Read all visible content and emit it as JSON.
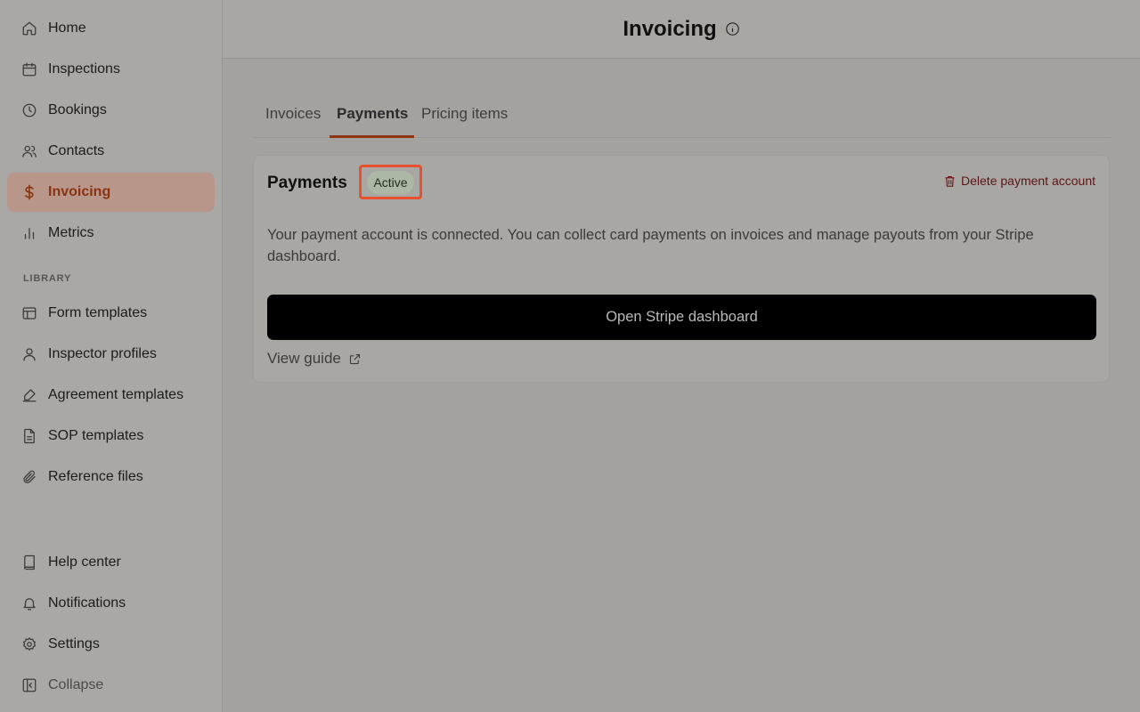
{
  "sidebar": {
    "items": [
      {
        "label": "Home",
        "icon": "home-icon"
      },
      {
        "label": "Inspections",
        "icon": "calendar-icon"
      },
      {
        "label": "Bookings",
        "icon": "clock-icon"
      },
      {
        "label": "Contacts",
        "icon": "users-icon"
      },
      {
        "label": "Invoicing",
        "icon": "dollar-icon",
        "active": true
      },
      {
        "label": "Metrics",
        "icon": "bar-chart-icon"
      }
    ],
    "library_label": "LIBRARY",
    "library_items": [
      {
        "label": "Form templates",
        "icon": "layout-icon"
      },
      {
        "label": "Inspector profiles",
        "icon": "user-icon"
      },
      {
        "label": "Agreement templates",
        "icon": "signature-icon"
      },
      {
        "label": "SOP templates",
        "icon": "document-icon"
      },
      {
        "label": "Reference files",
        "icon": "paperclip-icon"
      }
    ],
    "bottom_items": [
      {
        "label": "Help center",
        "icon": "book-icon"
      },
      {
        "label": "Notifications",
        "icon": "bell-icon"
      },
      {
        "label": "Settings",
        "icon": "gear-icon"
      },
      {
        "label": "Collapse",
        "icon": "sidebar-collapse-icon"
      }
    ]
  },
  "header": {
    "title": "Invoicing",
    "info_icon": "info-icon"
  },
  "tabs": [
    {
      "label": "Invoices"
    },
    {
      "label": "Payments",
      "active": true
    },
    {
      "label": "Pricing items"
    }
  ],
  "card": {
    "title": "Payments",
    "status_badge": "Active",
    "delete_label": "Delete payment account",
    "description": "Your payment account is connected. You can collect card payments on invoices and manage payouts from your Stripe dashboard.",
    "primary_button": "Open Stripe dashboard",
    "guide_label": "View guide"
  },
  "colors": {
    "accent": "#8a3310",
    "highlight_border": "#e8502e",
    "badge_bg": "#adb7a6",
    "button_bg": "#000000"
  }
}
